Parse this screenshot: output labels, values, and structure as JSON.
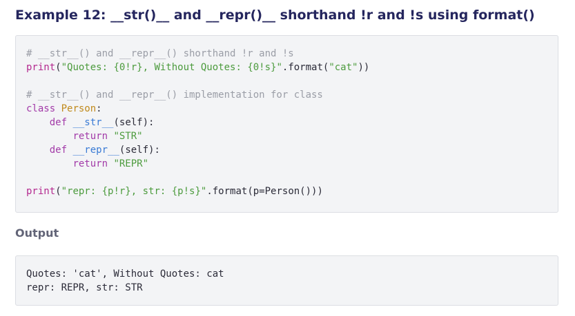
{
  "heading": "Example 12: __str()__ and __repr()__ shorthand !r and !s using format()",
  "code": {
    "lines": [
      {
        "tokens": [
          {
            "t": "cm",
            "v": "# __str__() and __repr__() shorthand !r and !s"
          }
        ]
      },
      {
        "tokens": [
          {
            "t": "fn",
            "v": "print"
          },
          {
            "t": "plain",
            "v": "("
          },
          {
            "t": "str",
            "v": "\"Quotes: {0!r}, Without Quotes: {0!s}\""
          },
          {
            "t": "plain",
            "v": ".format("
          },
          {
            "t": "str",
            "v": "\"cat\""
          },
          {
            "t": "plain",
            "v": "))"
          }
        ]
      },
      {
        "tokens": []
      },
      {
        "tokens": [
          {
            "t": "cm",
            "v": "# __str__() and __repr__() implementation for class"
          }
        ]
      },
      {
        "tokens": [
          {
            "t": "kw",
            "v": "class"
          },
          {
            "t": "plain",
            "v": " "
          },
          {
            "t": "cls",
            "v": "Person"
          },
          {
            "t": "plain",
            "v": ":"
          }
        ]
      },
      {
        "tokens": [
          {
            "t": "plain",
            "v": "    "
          },
          {
            "t": "kw",
            "v": "def"
          },
          {
            "t": "plain",
            "v": " "
          },
          {
            "t": "dunder",
            "v": "__str__"
          },
          {
            "t": "plain",
            "v": "(self):"
          }
        ]
      },
      {
        "tokens": [
          {
            "t": "plain",
            "v": "        "
          },
          {
            "t": "kw",
            "v": "return"
          },
          {
            "t": "plain",
            "v": " "
          },
          {
            "t": "str",
            "v": "\"STR\""
          }
        ]
      },
      {
        "tokens": [
          {
            "t": "plain",
            "v": "    "
          },
          {
            "t": "kw",
            "v": "def"
          },
          {
            "t": "plain",
            "v": " "
          },
          {
            "t": "dunder",
            "v": "__repr__"
          },
          {
            "t": "plain",
            "v": "(self):"
          }
        ]
      },
      {
        "tokens": [
          {
            "t": "plain",
            "v": "        "
          },
          {
            "t": "kw",
            "v": "return"
          },
          {
            "t": "plain",
            "v": " "
          },
          {
            "t": "str",
            "v": "\"REPR\""
          }
        ]
      },
      {
        "tokens": []
      },
      {
        "tokens": [
          {
            "t": "fn",
            "v": "print"
          },
          {
            "t": "plain",
            "v": "("
          },
          {
            "t": "str",
            "v": "\"repr: {p!r}, str: {p!s}\""
          },
          {
            "t": "plain",
            "v": ".format(p=Person()))"
          }
        ]
      }
    ]
  },
  "output_heading": "Output",
  "output": {
    "lines": [
      "Quotes: 'cat', Without Quotes: cat",
      "repr: REPR, str: STR"
    ]
  },
  "colors": {
    "heading": "#25265e",
    "subheading": "#626477",
    "code_background": "#f3f4f6",
    "code_border": "#dcdee3",
    "comment": "#9a9da6",
    "builtin_function": "#b4298f",
    "string": "#4c9b3d",
    "keyword": "#a23aa8",
    "class_name": "#c08a1c",
    "method_name": "#3a7bd5",
    "plain_text": "#2b2b38"
  }
}
